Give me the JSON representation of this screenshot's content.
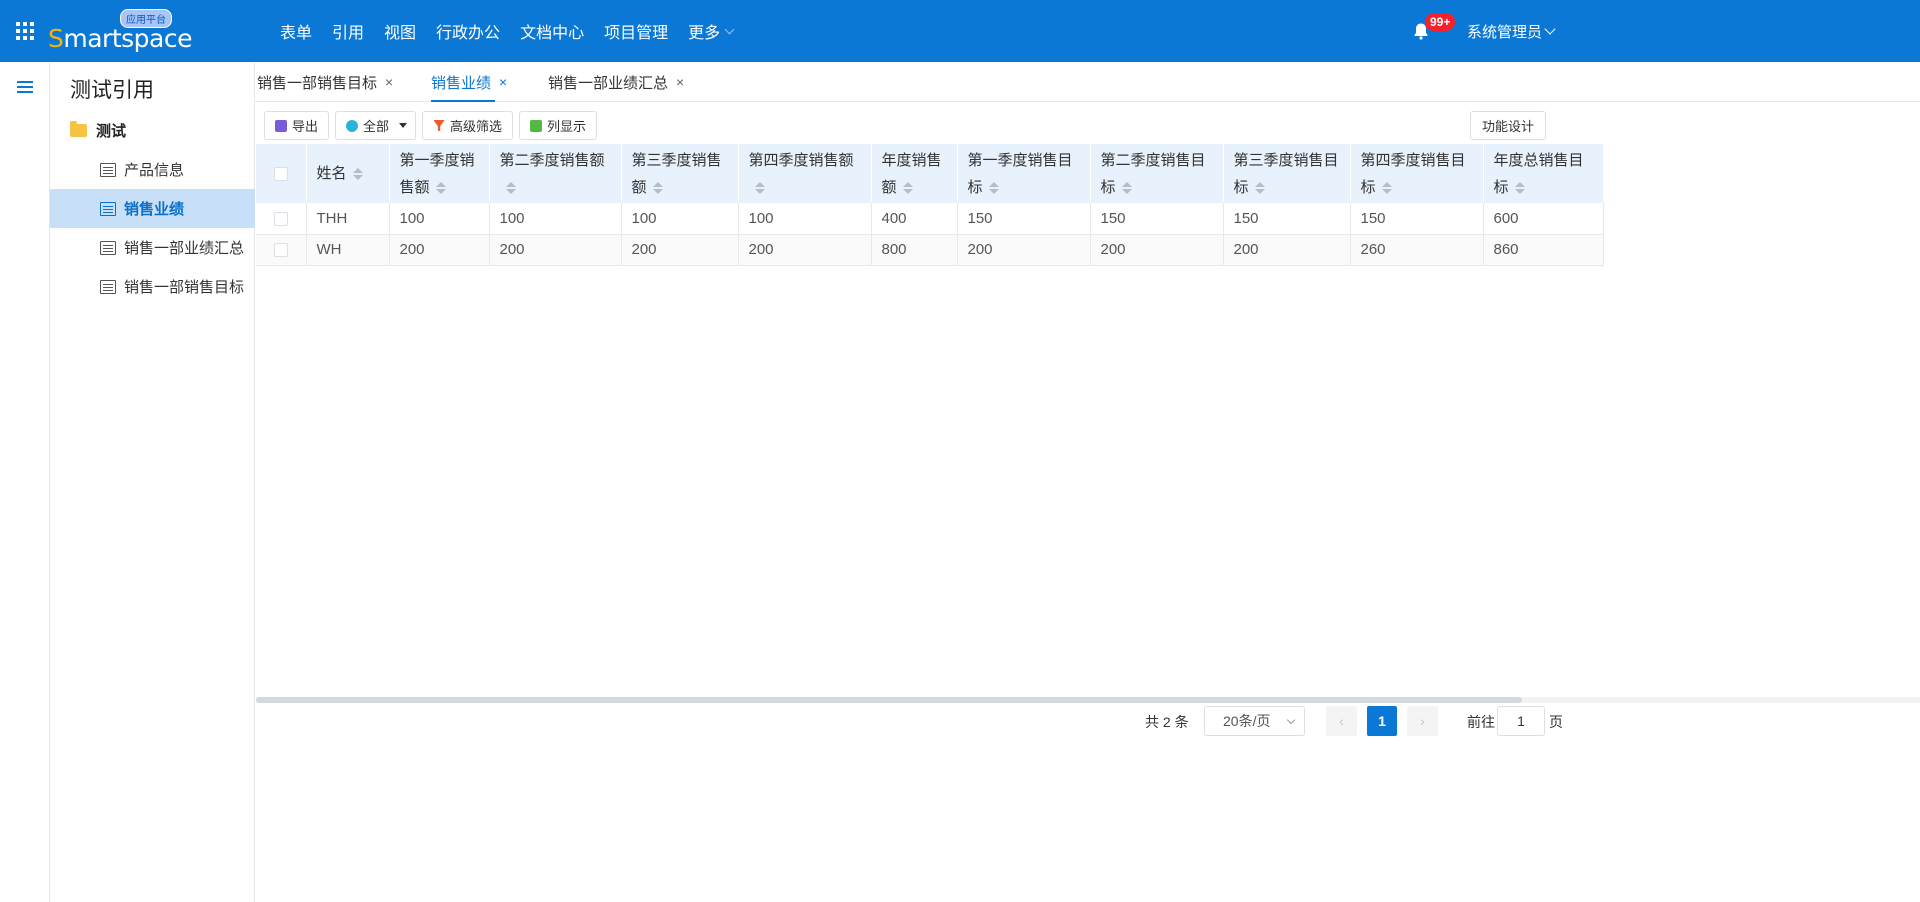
{
  "header": {
    "logo_text": "Smartspace",
    "logo_badge": "应用平台",
    "nav": [
      "表单",
      "引用",
      "视图",
      "行政办公",
      "文档中心",
      "项目管理"
    ],
    "nav_more": "更多",
    "notification_count": "99+",
    "user": "系统管理员",
    "brand_color": "#0b78d6"
  },
  "sidebar": {
    "title": "测试引用",
    "folder": "测试",
    "items": [
      {
        "label": "产品信息"
      },
      {
        "label": "销售业绩",
        "active": true
      },
      {
        "label": "销售一部业绩汇总"
      },
      {
        "label": "销售一部销售目标"
      }
    ]
  },
  "tabs": [
    {
      "label": "销售一部销售目标",
      "close": "×"
    },
    {
      "label": "销售业绩",
      "close": "×",
      "active": true
    },
    {
      "label": "销售一部业绩汇总",
      "close": "×"
    }
  ],
  "toolbar": {
    "export": "导出",
    "scope": "全部",
    "filter": "高级筛选",
    "columns": "列显示",
    "func_design": "功能设计"
  },
  "table": {
    "headers": [
      "姓名",
      "第一季度销售额",
      "第二季度销售额",
      "第三季度销售额",
      "第四季度销售额",
      "年度销售额",
      "第一季度销售目标",
      "第二季度销售目标",
      "第三季度销售目标",
      "第四季度销售目标",
      "年度总销售目标"
    ],
    "rows": [
      [
        "THH",
        "100",
        "100",
        "100",
        "100",
        "400",
        "150",
        "150",
        "150",
        "150",
        "600"
      ],
      [
        "WH",
        "200",
        "200",
        "200",
        "200",
        "800",
        "200",
        "200",
        "200",
        "260",
        "860"
      ]
    ]
  },
  "pagination": {
    "total": "共 2 条",
    "page_size": "20条/页",
    "prev": "‹",
    "current": "1",
    "next": "›",
    "goto_label": "前往",
    "goto_value": "1",
    "page_suffix": "页"
  }
}
